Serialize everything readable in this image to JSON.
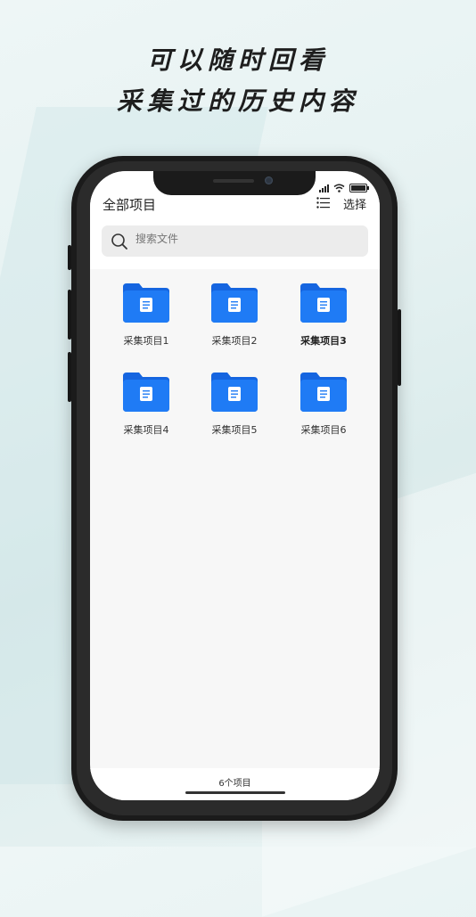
{
  "promo": {
    "line1": "可以随时回看",
    "line2": "采集过的历史内容"
  },
  "header": {
    "title": "全部项目",
    "list_icon": "list-icon",
    "select_label": "选择"
  },
  "search": {
    "placeholder": "搜索文件",
    "icon": "search-icon"
  },
  "folders": [
    {
      "label": "采集项目1",
      "icon": "folder-icon"
    },
    {
      "label": "采集项目2",
      "icon": "folder-icon"
    },
    {
      "label": "采集项目3",
      "icon": "folder-icon",
      "emphasized": true
    },
    {
      "label": "采集项目4",
      "icon": "folder-icon"
    },
    {
      "label": "采集项目5",
      "icon": "folder-icon"
    },
    {
      "label": "采集项目6",
      "icon": "folder-icon"
    }
  ],
  "footer": {
    "count": "6个项目"
  },
  "colors": {
    "folder_blue": "#1f7bf5",
    "folder_tab": "#1565e0"
  }
}
